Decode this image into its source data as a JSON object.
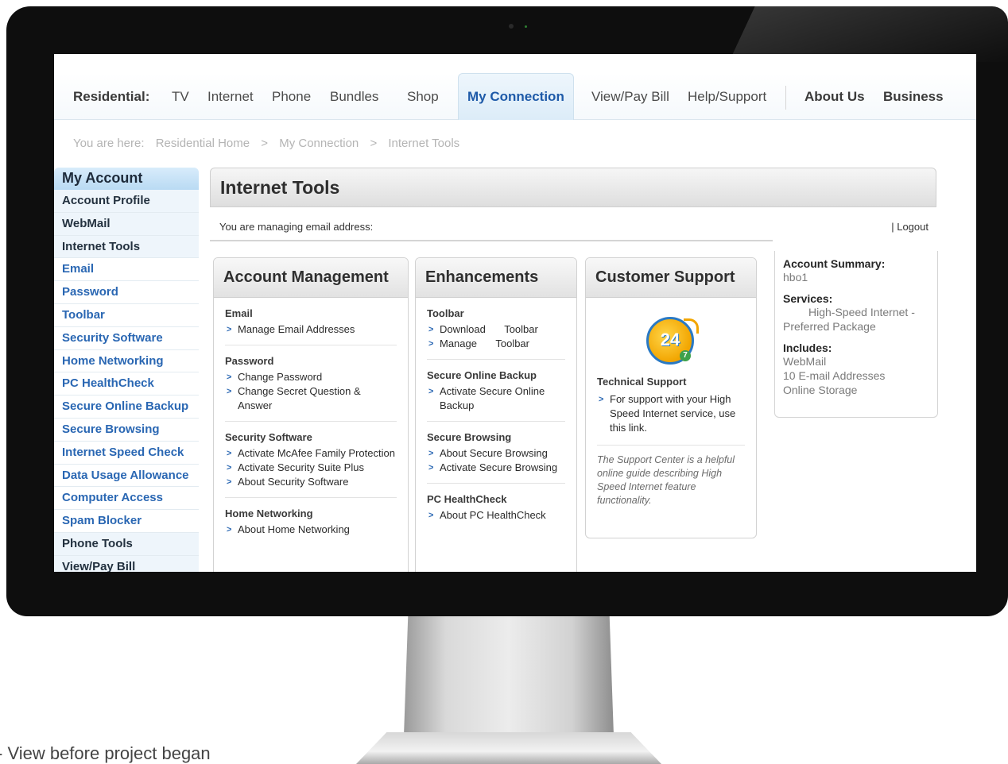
{
  "nav": {
    "residential": "Residential:",
    "tv": "TV",
    "internet": "Internet",
    "phone": "Phone",
    "bundles": "Bundles",
    "shop": "Shop",
    "my_connection": "My Connection",
    "view_pay_bill": "View/Pay Bill",
    "help_support": "Help/Support",
    "about_us": "About Us",
    "business": "Business"
  },
  "breadcrumb": {
    "prefix": "You are here:",
    "items": [
      "Residential Home",
      "My Connection",
      "Internet Tools"
    ],
    "separator": ">"
  },
  "sidebar": {
    "header": "My Account",
    "items": [
      {
        "label": "Account Profile",
        "style": "plain"
      },
      {
        "label": "WebMail",
        "style": "plain"
      },
      {
        "label": "Internet Tools",
        "style": "plain"
      },
      {
        "label": "Email",
        "style": "link"
      },
      {
        "label": "Password",
        "style": "link"
      },
      {
        "label": "Toolbar",
        "style": "link"
      },
      {
        "label": "Security Software",
        "style": "link"
      },
      {
        "label": "Home Networking",
        "style": "link"
      },
      {
        "label": "PC HealthCheck",
        "style": "link"
      },
      {
        "label": "Secure Online Backup",
        "style": "link"
      },
      {
        "label": "Secure Browsing",
        "style": "link"
      },
      {
        "label": "Internet Speed Check",
        "style": "link"
      },
      {
        "label": "Data Usage Allowance",
        "style": "link"
      },
      {
        "label": "Computer Access",
        "style": "link"
      },
      {
        "label": "Spam Blocker",
        "style": "link"
      },
      {
        "label": "Phone Tools",
        "style": "plain"
      },
      {
        "label": "View/Pay Bill",
        "style": "plain"
      }
    ]
  },
  "main": {
    "title": "Internet Tools",
    "managing_text": "You are managing email address:",
    "logout": "| Logout"
  },
  "account_management": {
    "title": "Account Management",
    "email_title": "Email",
    "manage_email": "Manage Email Addresses",
    "password_title": "Password",
    "change_password": "Change Password",
    "change_secret": "Change Secret Question & Answer",
    "security_title": "Security Software",
    "activate_mcafee": "Activate McAfee Family Protection",
    "activate_suite": "Activate Security Suite Plus",
    "about_security": "About Security Software",
    "home_net_title": "Home Networking",
    "about_home_net": "About Home Networking"
  },
  "enhancements": {
    "title": "Enhancements",
    "toolbar_title": "Toolbar",
    "download": "Download Toolbar",
    "manage": "Manage Toolbar",
    "backup_title": "Secure Online Backup",
    "activate_backup": "Activate Secure Online Backup",
    "browsing_title": "Secure Browsing",
    "about_browsing": "About Secure Browsing",
    "activate_browsing": "Activate Secure Browsing",
    "pc_title": "PC HealthCheck",
    "about_pc": "About PC HealthCheck"
  },
  "customer_support": {
    "title": "Customer Support",
    "badge_text": "24",
    "badge_small": "7",
    "tech_title": "Technical Support",
    "tech_link": "For support with your High Speed Internet service, use this link.",
    "note": "The Support Center is a helpful online guide describing High Speed Internet feature functionality."
  },
  "summary": {
    "label": "Account Summary:",
    "user": "hbo1",
    "services_label": "Services:",
    "services_value_1": "High-Speed Internet -",
    "services_value_2": "Preferred Package",
    "includes_label": "Includes:",
    "includes": [
      "WebMail",
      "10 E-mail Addresses",
      "Online Storage"
    ]
  },
  "caption": "- View before project began",
  "colors": {
    "accent_link": "#2a67b3",
    "active_tab": "#1e5aa8",
    "bezel": "#0e0e0e"
  }
}
